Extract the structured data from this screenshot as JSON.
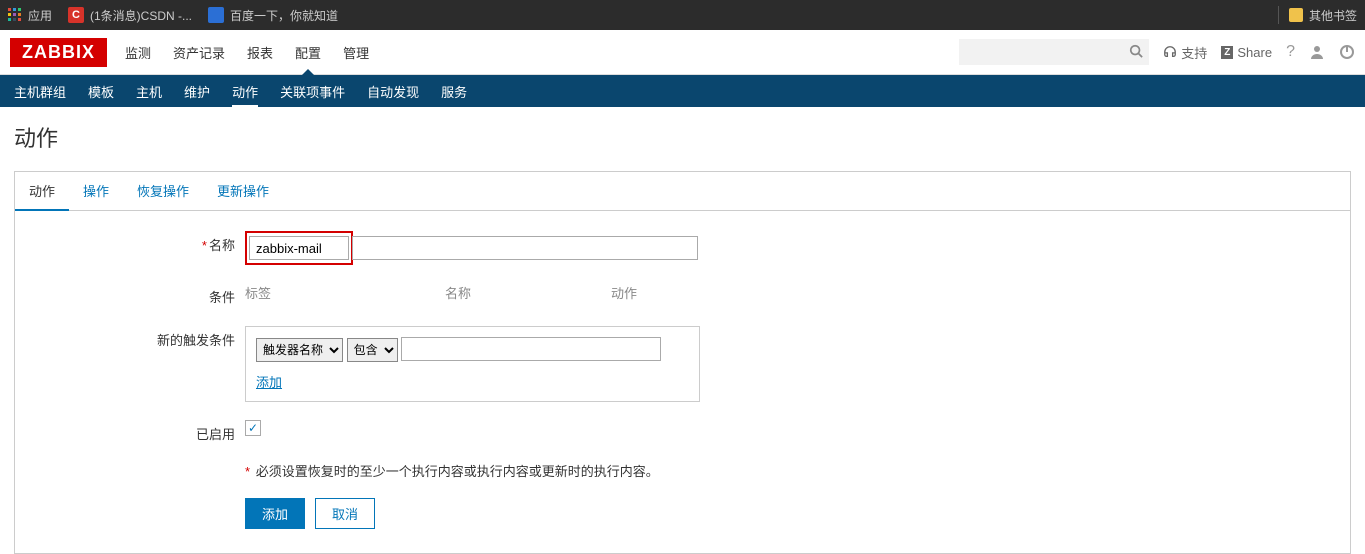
{
  "browser": {
    "apps_label": "应用",
    "csdn_label": "(1条消息)CSDN -...",
    "baidu_label": "百度一下，你就知道",
    "other_bookmarks": "其他书签"
  },
  "header": {
    "logo_text": "ZABBIX",
    "nav": [
      "监测",
      "资产记录",
      "报表",
      "配置",
      "管理"
    ],
    "active_index": 3,
    "search_placeholder": "",
    "support_label": "支持",
    "share_label": "Share"
  },
  "subnav": {
    "items": [
      "主机群组",
      "模板",
      "主机",
      "维护",
      "动作",
      "关联项事件",
      "自动发现",
      "服务"
    ],
    "active_index": 4
  },
  "page": {
    "title": "动作"
  },
  "tabs": {
    "items": [
      "动作",
      "操作",
      "恢复操作",
      "更新操作"
    ],
    "active_index": 0
  },
  "form": {
    "name_label": "名称",
    "name_value": "zabbix-mail",
    "conditions_label": "条件",
    "conditions_headers": [
      "标签",
      "名称",
      "动作"
    ],
    "new_condition_label": "新的触发条件",
    "trigger_select_value": "触发器名称",
    "operator_select_value": "包含",
    "add_link": "添加",
    "enabled_label": "已启用",
    "enabled_checked": true,
    "warning": "必须设置恢复时的至少一个执行内容或执行内容或更新时的执行内容。",
    "submit_label": "添加",
    "cancel_label": "取消"
  }
}
